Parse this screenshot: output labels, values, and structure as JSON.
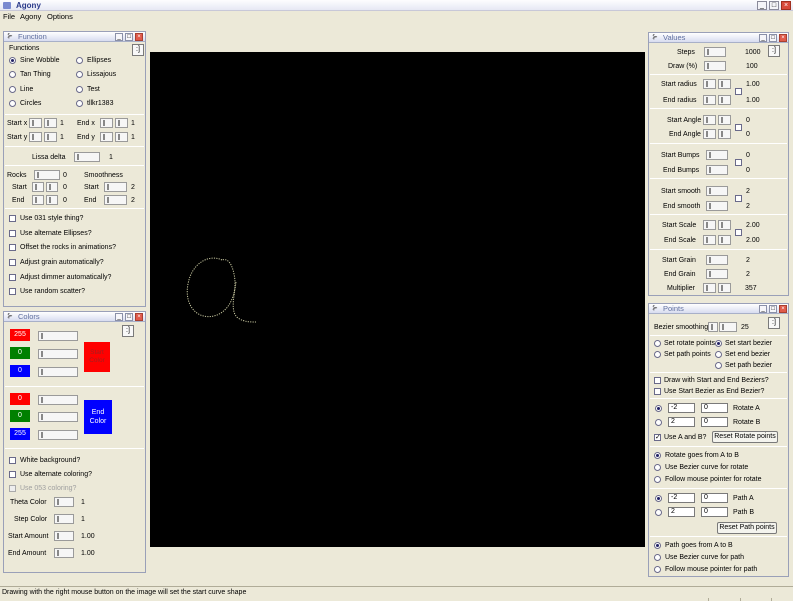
{
  "app": {
    "title": "Agony",
    "colors": {
      "canvas_bg": "#000000",
      "curve": "#c8c8a0",
      "red": "#ff0000",
      "green": "#008000",
      "blue": "#0000ff"
    }
  },
  "menu": [
    "File",
    "Agony",
    "Options"
  ],
  "function_panel": {
    "title": "Function",
    "pin": ":]",
    "group_label": "Functions",
    "options": [
      "Sine Wobble",
      "Ellipses",
      "Tan Thing",
      "Lissajous",
      "Line",
      "Test",
      "Circles",
      "tllkr1383"
    ],
    "selected": "Sine Wobble",
    "start_x_label": "Start x",
    "start_x": "1",
    "end_x_label": "End x",
    "end_x": "1",
    "start_y_label": "Start y",
    "start_y": "1",
    "end_y_label": "End y",
    "end_y": "1",
    "lissa_delta_label": "Lissa delta",
    "lissa_delta": "1",
    "rocks_label": "Rocks",
    "rocks": "0",
    "smoothness_label": "Smoothness",
    "rocks_start_label": "Start",
    "rocks_start": "0",
    "rocks_end_label": "End",
    "rocks_end": "0",
    "smooth_start_label": "Start",
    "smooth_start": "2",
    "smooth_end_label": "End",
    "smooth_end": "2",
    "checks": [
      "Use 031 style thing?",
      "Use alternate Ellipses?",
      "Offset the rocks in animations?",
      "Adjust grain automatically?",
      "Adjust dimmer automatically?",
      "Use random scatter?"
    ]
  },
  "colors_panel": {
    "title": "Colors",
    "pin": ":]",
    "start_rgb": [
      "255",
      "0",
      "0"
    ],
    "start_color_label": "Start Color",
    "end_rgb": [
      "0",
      "0",
      "255"
    ],
    "end_color_label": "End Color",
    "checks": [
      "White background?",
      "Use alternate coloring?",
      "Use 053 coloring?"
    ],
    "theta_color_label": "Theta Color",
    "theta_color": "1",
    "step_color_label": "Step Color",
    "step_color": "1",
    "start_amount_label": "Start Amount",
    "start_amount": "1.00",
    "end_amount_label": "End Amount",
    "end_amount": "1.00"
  },
  "values_panel": {
    "title": "Values",
    "pin": ":]",
    "steps_label": "Steps",
    "steps": "1000",
    "draw_label": "Draw (%)",
    "draw": "100",
    "start_radius_label": "Start radius",
    "start_radius": "1.00",
    "end_radius_label": "End radius",
    "end_radius": "1.00",
    "start_angle_label": "Start Angle",
    "start_angle": "0",
    "end_angle_label": "End Angle",
    "end_angle": "0",
    "start_bumps_label": "Start Bumps",
    "start_bumps": "0",
    "end_bumps_label": "End Bumps",
    "end_bumps": "0",
    "start_smooth_label": "Start smooth",
    "start_smooth": "2",
    "end_smooth_label": "End smooth",
    "end_smooth": "2",
    "start_scale_label": "Start Scale",
    "start_scale": "2.00",
    "end_scale_label": "End Scale",
    "end_scale": "2.00",
    "start_grain_label": "Start Grain",
    "start_grain": "2",
    "end_grain_label": "End Grain",
    "end_grain": "2",
    "multiplier_label": "Multiplier",
    "multiplier": "357"
  },
  "points_panel": {
    "title": "Points",
    "pin": ":]",
    "bezier_smoothing_label": "Bezier smoothing",
    "bezier_smoothing": "25",
    "set_rotate_points": "Set rotate points",
    "set_start_bezier": "Set start bezier",
    "set_path_points": "Set path points",
    "set_end_bezier": "Set end bezier",
    "set_path_bezier": "Set path bezier",
    "draw_with_bezier": "Draw with Start and End Beziers?",
    "use_start_as_end": "Use Start Bezier as End Bezier?",
    "rotate_a": [
      "-2",
      "0"
    ],
    "rotate_a_label": "Rotate A",
    "rotate_b": [
      "2",
      "0"
    ],
    "rotate_b_label": "Rotate B",
    "use_a_and_b": "Use A and B?",
    "reset_rotate": "Reset Rotate points",
    "rotate_opts": [
      "Rotate goes from A to B",
      "Use Bezier curve for rotate",
      "Follow mouse pointer for rotate"
    ],
    "path_a": [
      "-2",
      "0"
    ],
    "path_a_label": "Path A",
    "path_b": [
      "2",
      "0"
    ],
    "path_b_label": "Path B",
    "reset_path": "Reset Path points",
    "path_opts": [
      "Path goes from A to B",
      "Use Bezier curve for path",
      "Follow mouse pointer for path"
    ]
  },
  "status": {
    "text": "Drawing with the right mouse button on the image will set the start curve shape"
  }
}
